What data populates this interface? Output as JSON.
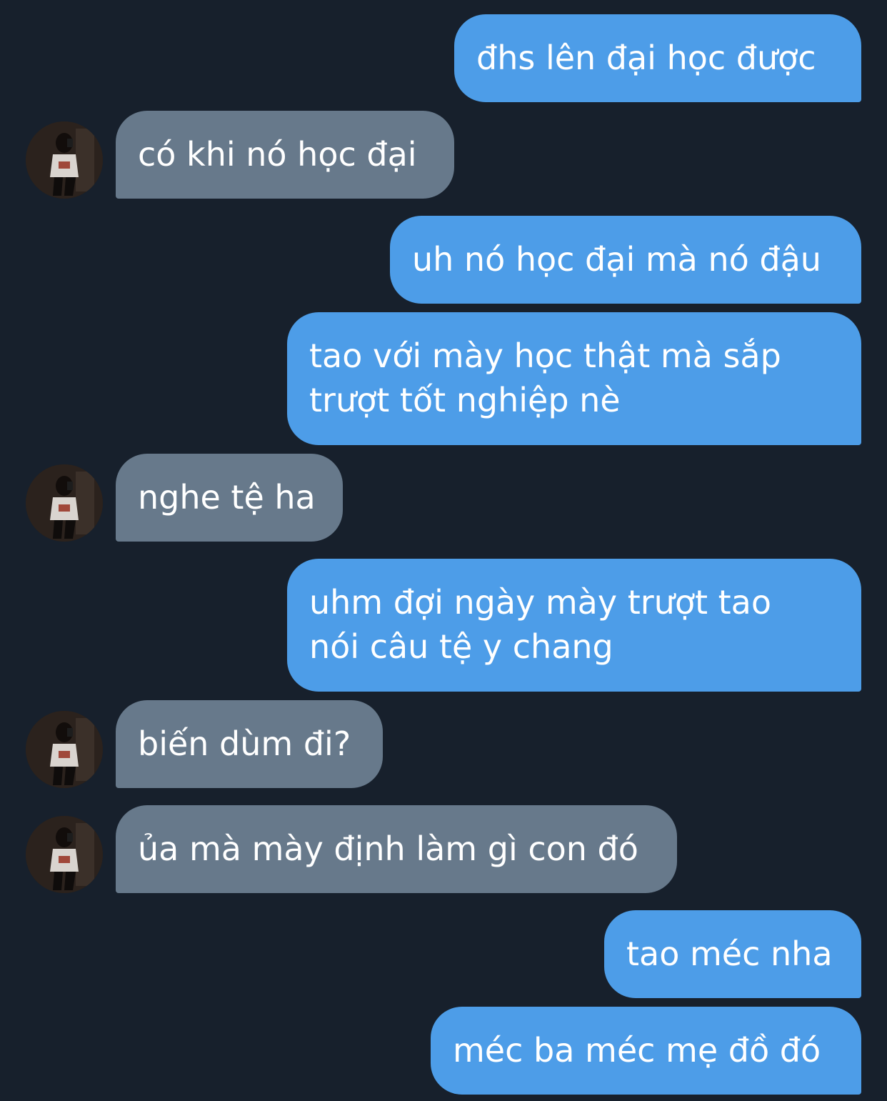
{
  "conversation": {
    "messages": [
      {
        "direction": "outgoing",
        "text": "đhs lên đại học được"
      },
      {
        "direction": "incoming",
        "text": "có khi nó học đại"
      },
      {
        "direction": "outgoing",
        "text": "uh nó học đại mà nó đậu"
      },
      {
        "direction": "outgoing",
        "text": "tao với mày học thật mà sắp\ntrượt tốt nghiệp nè"
      },
      {
        "direction": "incoming",
        "text": "nghe tệ ha"
      },
      {
        "direction": "outgoing",
        "text": "uhm đợi ngày mày trượt tao\nnói câu tệ y chang"
      },
      {
        "direction": "incoming",
        "text": "biến dùm đi?"
      },
      {
        "direction": "incoming",
        "text": "ủa mà mày định làm gì con đó"
      },
      {
        "direction": "outgoing",
        "text": "tao méc nha"
      },
      {
        "direction": "outgoing",
        "text": "méc ba méc mẹ đồ đó"
      }
    ]
  },
  "colors": {
    "background": "#17202c",
    "outgoing_bubble": "#4d9de8",
    "incoming_bubble": "#67798b",
    "text": "#ffffff"
  },
  "icons": {
    "avatar": "contact-avatar-photo"
  }
}
